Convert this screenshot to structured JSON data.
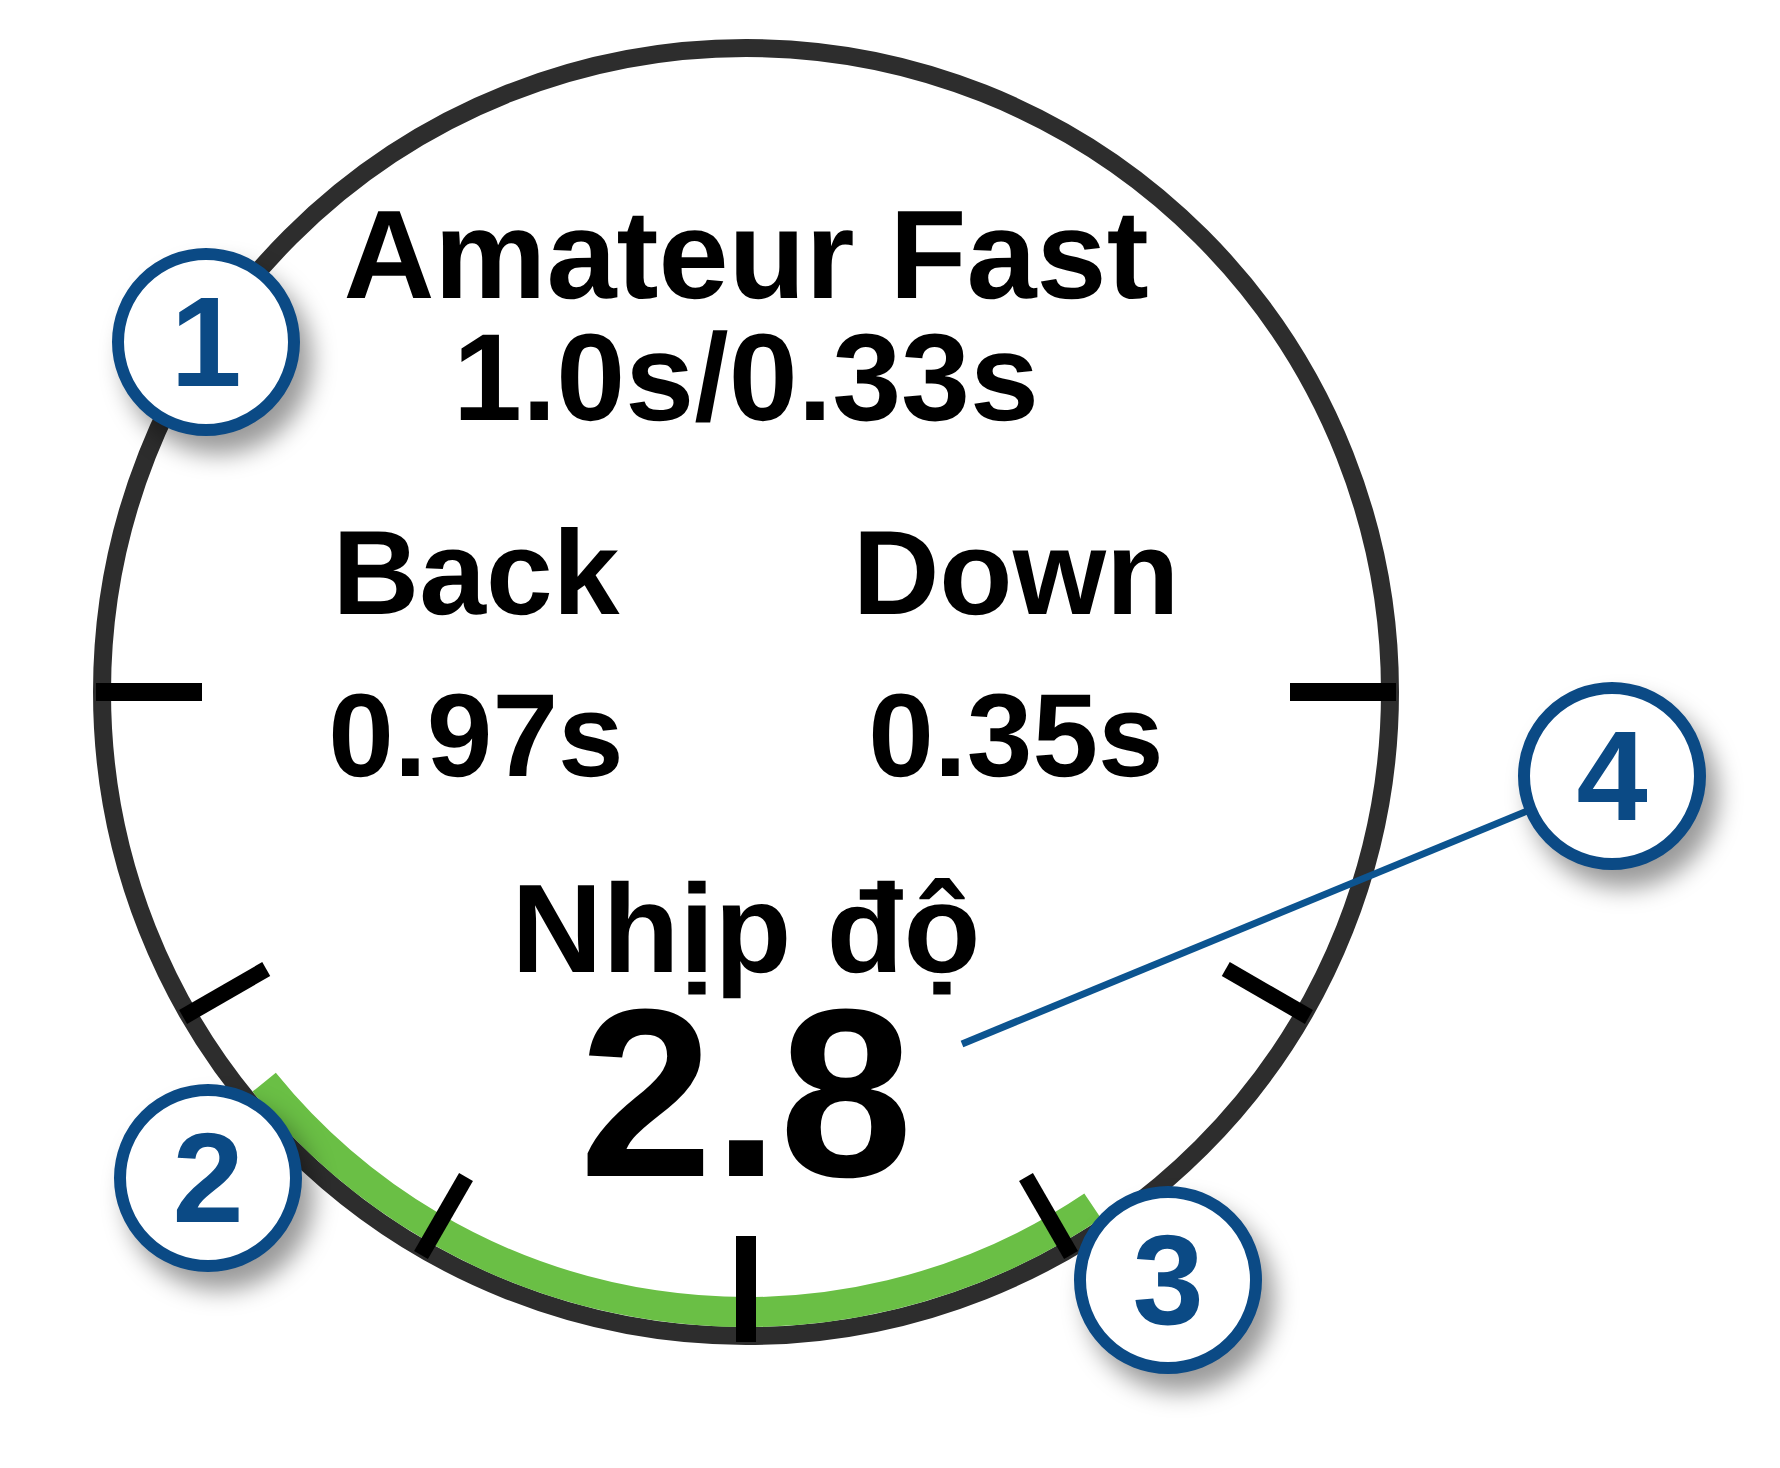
{
  "watch_face": {
    "title": "Amateur Fast",
    "subtitle": "1.0s/0.33s",
    "metrics": [
      {
        "label": "Back",
        "value": "0.97s"
      },
      {
        "label": "Down",
        "value": "0.35s"
      }
    ],
    "tempo": {
      "label": "Nhịp độ",
      "value": "2.8"
    }
  },
  "callouts": [
    {
      "number": "1",
      "leader": false
    },
    {
      "number": "2",
      "leader": false
    },
    {
      "number": "3",
      "leader": false
    },
    {
      "number": "4",
      "leader": true
    }
  ]
}
